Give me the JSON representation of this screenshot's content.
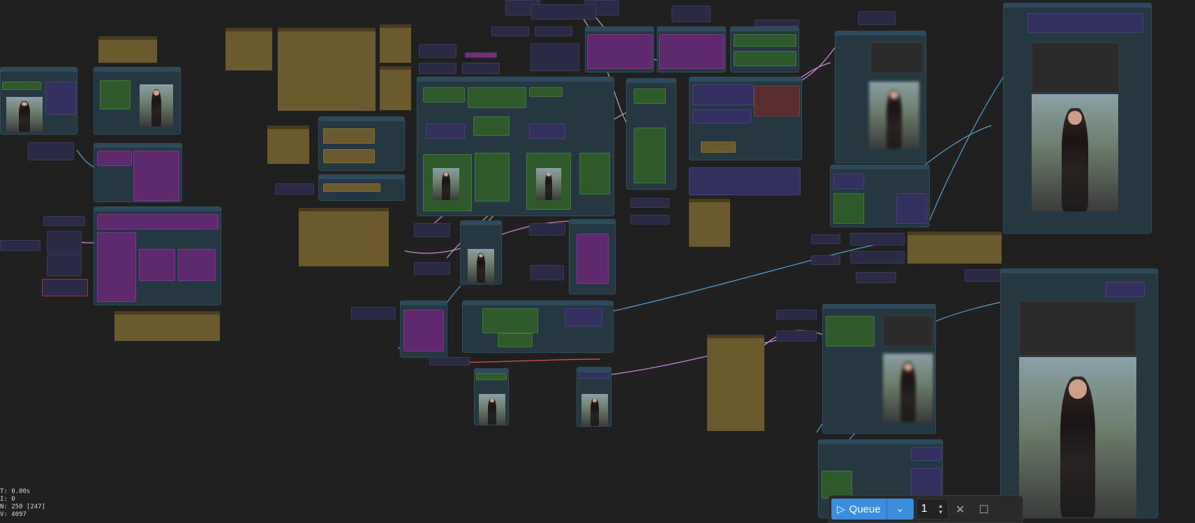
{
  "stats": {
    "time": "T: 0.00s",
    "iterations": "I: 0",
    "nodes": "N: 250 [247]",
    "vertices": "V: 4097"
  },
  "queue": {
    "play_icon": "play-icon",
    "label": "Queue",
    "dropdown_icon": "chevron-down-icon",
    "count": "1",
    "increment_icon": "caret-up-icon",
    "decrement_icon": "caret-down-icon",
    "clear_icon": "close-icon",
    "stop_icon": "square-icon"
  },
  "colors": {
    "canvas": "#202020",
    "node": "#253740",
    "accent": "#3b8de0"
  }
}
